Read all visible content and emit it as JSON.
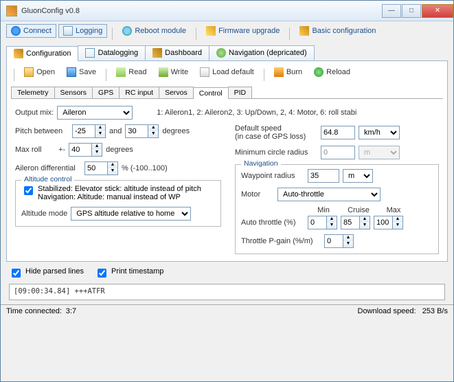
{
  "window_title": "GluonConfig v0.8",
  "toolbar": {
    "connect": "Connect",
    "logging": "Logging",
    "reboot": "Reboot module",
    "firmware": "Firmware upgrade",
    "basic": "Basic configuration"
  },
  "maintabs": {
    "configuration": "Configuration",
    "datalogging": "Datalogging",
    "dashboard": "Dashboard",
    "navigation": "Navigation (depricated)"
  },
  "filebar": {
    "open": "Open",
    "save": "Save",
    "read": "Read",
    "write": "Write",
    "loaddef": "Load default",
    "burn": "Burn",
    "reload": "Reload"
  },
  "subtabs": {
    "telemetry": "Telemetry",
    "sensors": "Sensors",
    "gps": "GPS",
    "rcinput": "RC input",
    "servos": "Servos",
    "control": "Control",
    "pid": "PID"
  },
  "control": {
    "output_mix_lbl": "Output mix:",
    "output_mix_val": "Aileron",
    "output_mix_help": "1: Aileron1, 2: Aileron2, 3: Up/Down, 2, 4: Motor, 6: roll stabi",
    "pitch_between_lbl": "Pitch between",
    "pitch_lo": "-25",
    "and": "and",
    "pitch_hi": "30",
    "degrees": "degrees",
    "max_roll_lbl": "Max roll",
    "max_roll_pm": "+-",
    "max_roll_val": "40",
    "ailerdiff_lbl": "Aileron differential",
    "ailerdiff_val": "50",
    "ailerdiff_range": "% (-100..100)",
    "altctrl_legend": "Altitude control",
    "stabilized_chk": "Stabilized: Elevator stick: altitude instead of pitch\nNavigation: Altitude: manual instead of WP",
    "altmode_lbl": "Altitude mode",
    "altmode_val": "GPS altitude relative to home",
    "defspeed_lbl": "Default speed\n(in case of GPS loss)",
    "defspeed_val": "64.8",
    "defspeed_unit": "km/h",
    "mincircle_lbl": "Minimum circle radius",
    "mincircle_val": "0",
    "mincircle_unit": "m",
    "nav_legend": "Navigation",
    "wpradius_lbl": "Waypoint radius",
    "wpradius_val": "35",
    "wpradius_unit": "m",
    "motor_lbl": "Motor",
    "motor_val": "Auto-throttle",
    "min_h": "Min",
    "cruise_h": "Cruise",
    "max_h": "Max",
    "autothr_lbl": "Auto throttle (%)",
    "autothr_min": "0",
    "autothr_cruise": "85",
    "autothr_max": "100",
    "thrpgain_lbl": "Throttle P-gain (%/m)",
    "thrpgain_val": "0"
  },
  "footer": {
    "hide_parsed": "Hide parsed lines",
    "print_ts": "Print timestamp",
    "log_line": "[09:00:34.84]  +++ATFR",
    "time_conn_lbl": "Time connected:",
    "time_conn_val": "3:7",
    "dl_lbl": "Download speed:",
    "dl_val": "253 B/s"
  }
}
